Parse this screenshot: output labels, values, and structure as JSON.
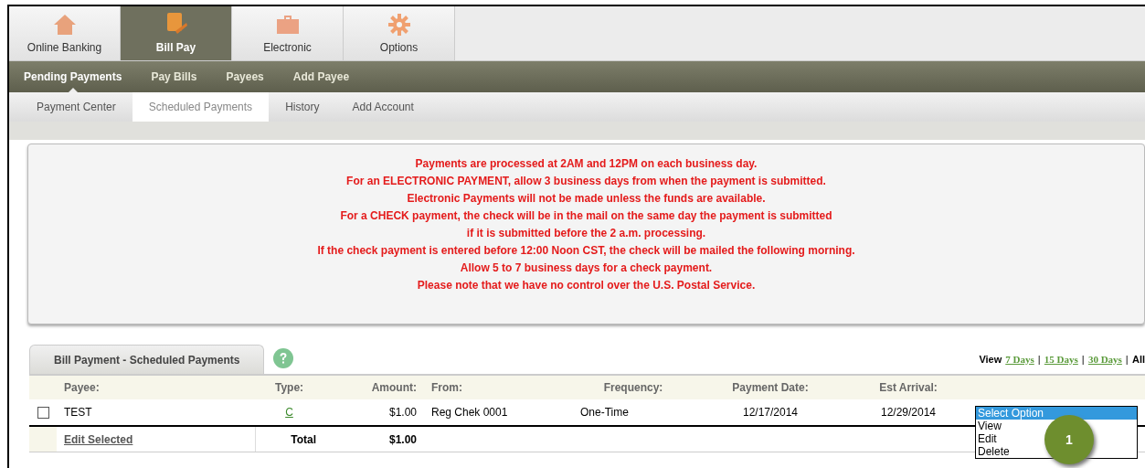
{
  "top_tabs": [
    {
      "label": "Online Banking",
      "selected": false
    },
    {
      "label": "Bill Pay",
      "selected": true
    },
    {
      "label": "Electronic",
      "selected": false
    },
    {
      "label": "Options",
      "selected": false
    }
  ],
  "nav": [
    {
      "label": "Pending Payments",
      "selected": true
    },
    {
      "label": "Pay Bills",
      "selected": false
    },
    {
      "label": "Payees",
      "selected": false
    },
    {
      "label": "Add Payee",
      "selected": false
    }
  ],
  "sub_tabs": [
    {
      "label": "Payment Center",
      "selected": false
    },
    {
      "label": "Scheduled Payments",
      "selected": true
    },
    {
      "label": "History",
      "selected": false
    },
    {
      "label": "Add Account",
      "selected": false
    }
  ],
  "notice": [
    "Payments are processed at 2AM and 12PM on each business day.",
    "For an ELECTRONIC PAYMENT, allow 3 business days from when the payment is submitted.",
    "Electronic Payments will not be made unless the funds are available.",
    "For a CHECK payment, the check will be in the mail on the same day the payment is submitted",
    "if it is submitted before the 2 a.m. processing.",
    "If the check payment is entered before 12:00 Noon CST, the check will be mailed the following morning.",
    "Allow 5 to 7 business days for a check payment.",
    "Please note that we have no control over the U.S. Postal Service."
  ],
  "panel_tab": "Bill Payment - Scheduled Payments",
  "view": {
    "label": "View",
    "separator": "|",
    "links": [
      {
        "label": "7 Days",
        "kind": "link"
      },
      {
        "label": "15 Days",
        "kind": "link"
      },
      {
        "label": "30 Days",
        "kind": "link"
      },
      {
        "label": "All",
        "kind": "current"
      }
    ]
  },
  "table": {
    "columns": [
      "Payee:",
      "Type:",
      "Amount:",
      "From:",
      "Frequency:",
      "Payment Date:",
      "Est Arrival:"
    ],
    "rows": [
      {
        "checked": false,
        "payee": "TEST",
        "type": "C",
        "amount": "$1.00",
        "from": "Reg Chek 0001",
        "frequency": "One-Time",
        "payment_date": "12/17/2014",
        "est_arrival": "12/29/2014",
        "action_menu": [
          {
            "label": "Select Option",
            "selected": true
          },
          {
            "label": "View",
            "selected": false
          },
          {
            "label": "Edit",
            "selected": false
          },
          {
            "label": "Delete",
            "selected": false
          }
        ]
      }
    ],
    "footer": {
      "edit_selected": "Edit Selected",
      "total_label": "Total",
      "total": "$1.00"
    }
  },
  "callout": "1"
}
